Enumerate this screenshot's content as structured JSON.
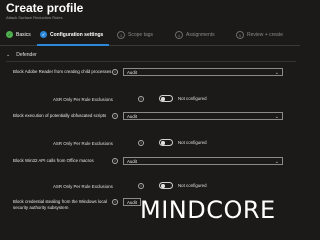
{
  "page": {
    "title": "Create profile",
    "subtitle": "Attack Surface Reduction Rules"
  },
  "tabs": [
    {
      "label": "Basics",
      "state": "done",
      "icon": "check"
    },
    {
      "label": "Configuration settings",
      "state": "active",
      "icon": "check"
    },
    {
      "label": "Scope tags",
      "state": "pending",
      "number": "3"
    },
    {
      "label": "Assignments",
      "state": "pending",
      "number": "4"
    },
    {
      "label": "Review + create",
      "state": "pending",
      "number": "5"
    }
  ],
  "section": {
    "label": "Defender"
  },
  "rules": [
    {
      "label": "Block Adobe Reader from creating child processes",
      "value": "Audit",
      "exclusion_label": "ASR Only Per Rule Exclusions",
      "exclusion_toggle": "Not configured"
    },
    {
      "label": "Block execution of potentially obfuscated scripts",
      "value": "Audit",
      "exclusion_label": "ASR Only Per Rule Exclusions",
      "exclusion_toggle": "Not configured"
    },
    {
      "label": "Block Win32 API calls from Office macros",
      "value": "Audit",
      "exclusion_label": "ASR Only Per Rule Exclusions",
      "exclusion_toggle": "Not configured"
    },
    {
      "label": "Block credential stealing from the Windows local security authority subsystem",
      "value": "Audit"
    }
  ],
  "watermark": "MINDCORE",
  "colors": {
    "background": "#1b1a19",
    "accent": "#2b88d8",
    "done": "#4fb24f"
  }
}
